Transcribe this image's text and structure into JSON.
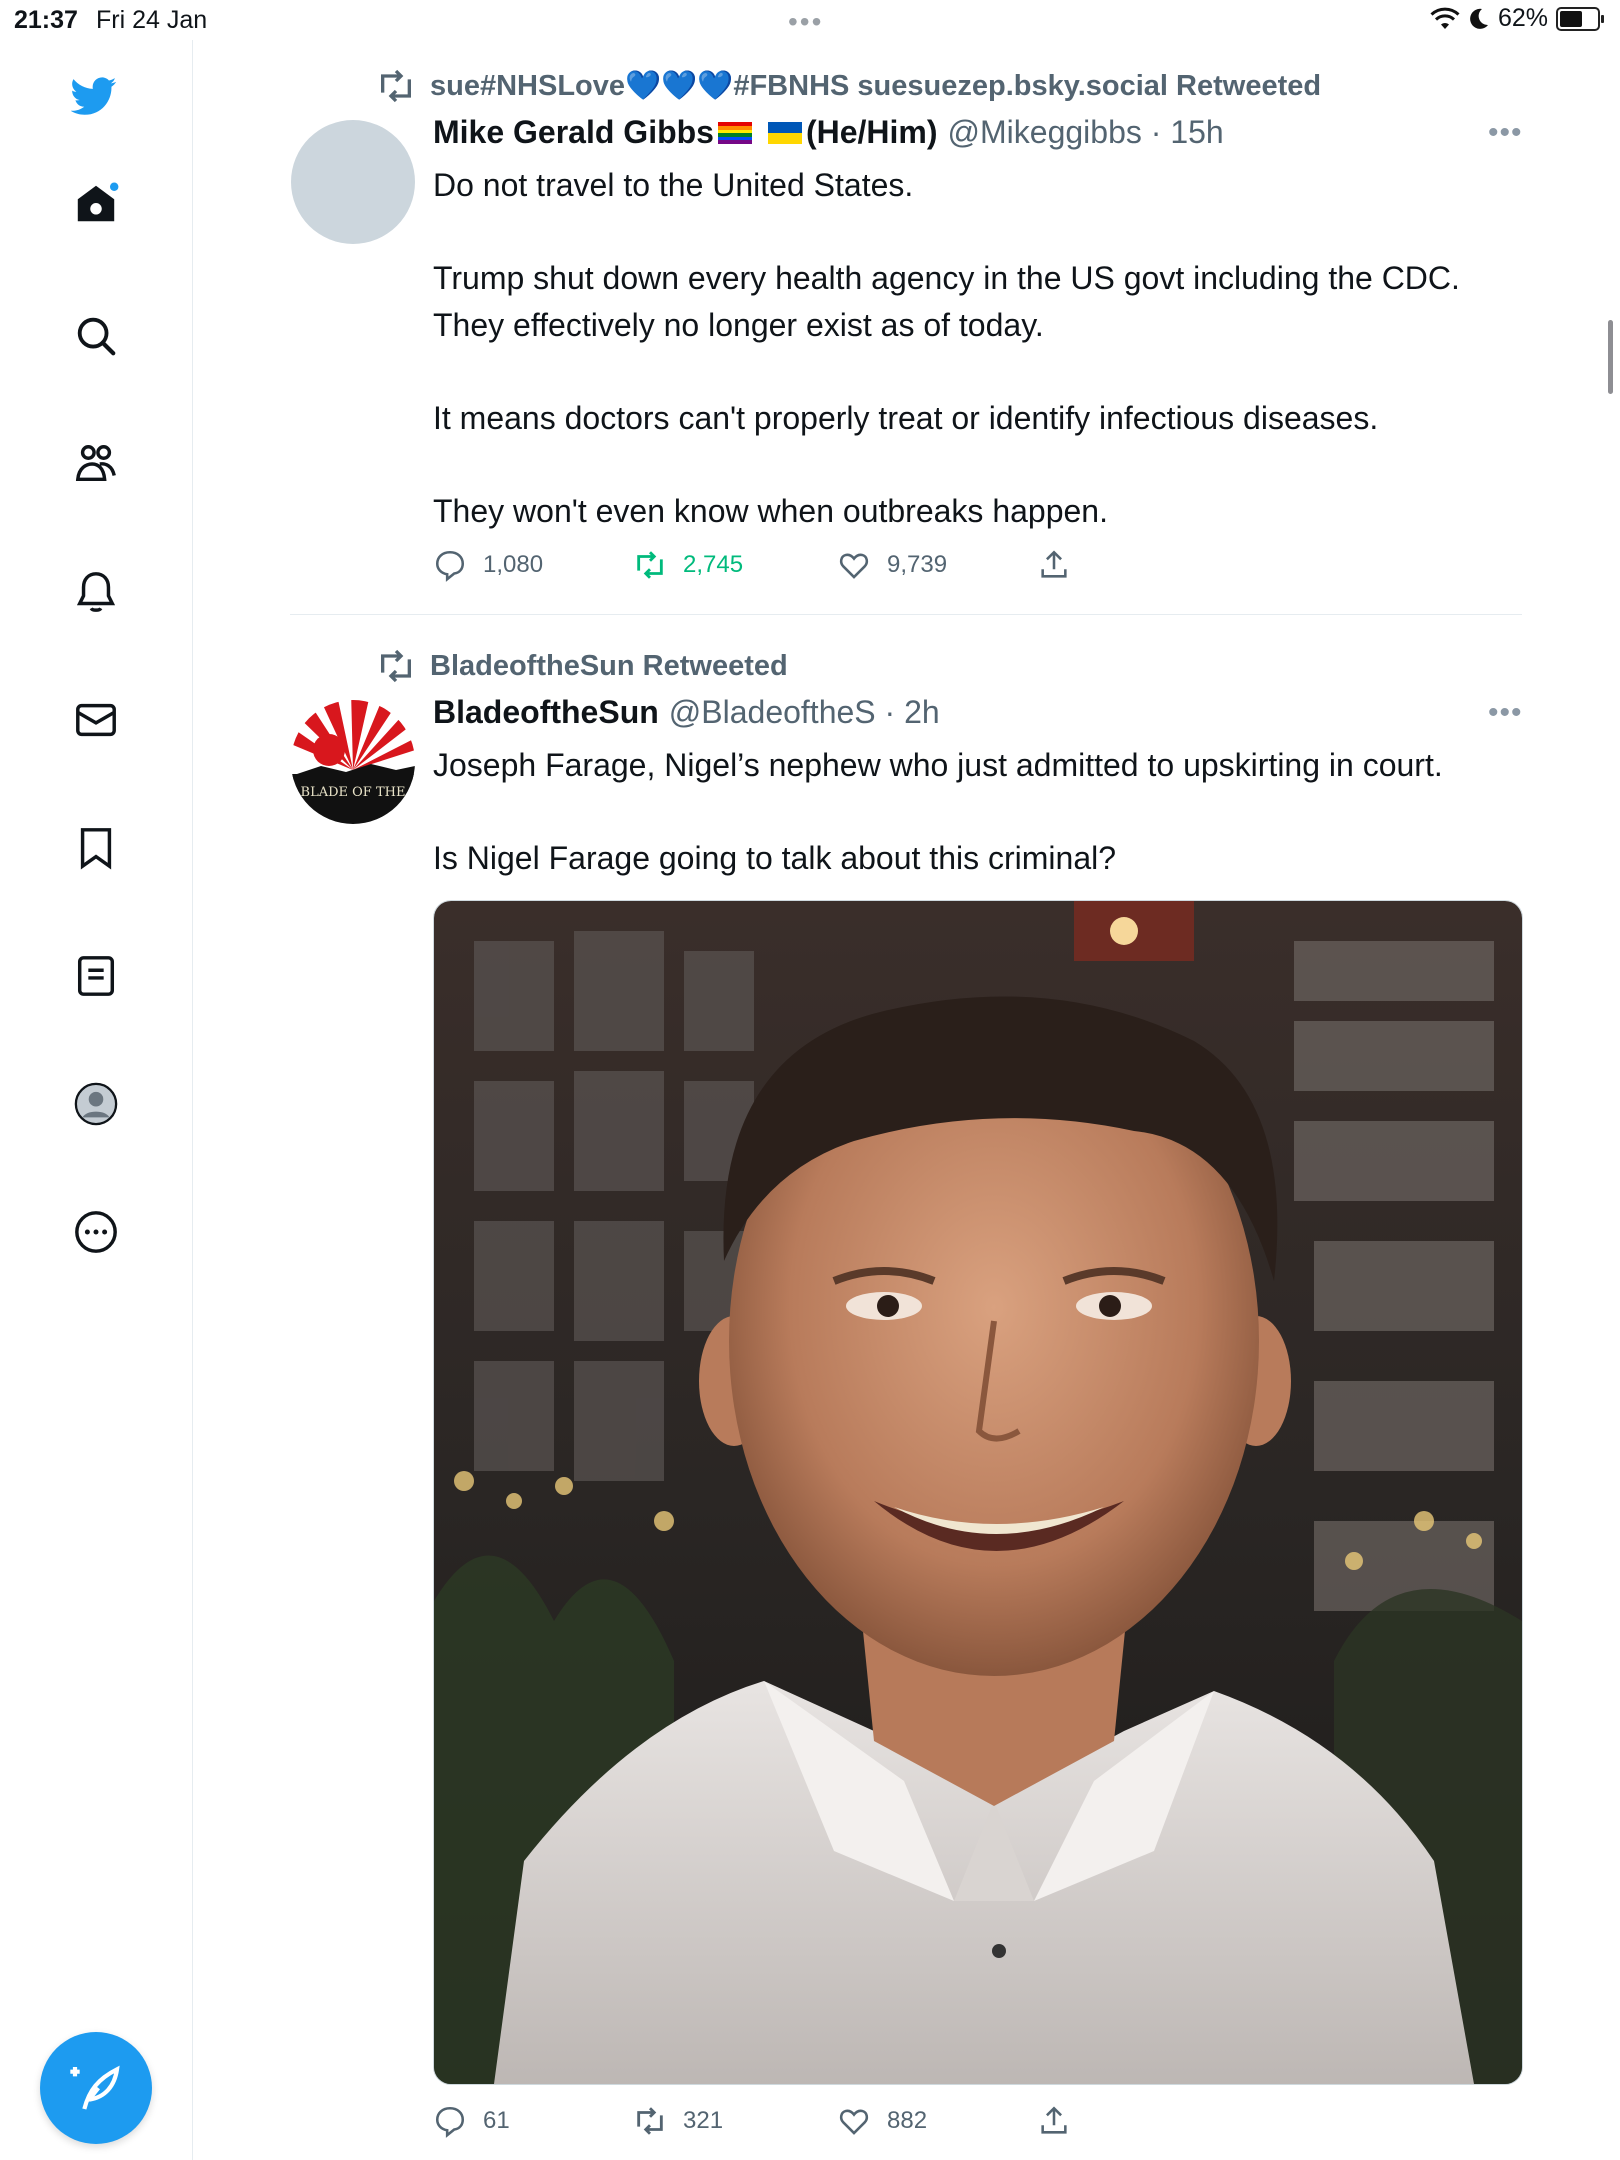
{
  "status_bar": {
    "time": "21:37",
    "date": "Fri 24 Jan",
    "battery": "62%",
    "battery_level": 0.62
  },
  "sidebar": {
    "items": [
      {
        "name": "home"
      },
      {
        "name": "search"
      },
      {
        "name": "communities"
      },
      {
        "name": "notifications"
      },
      {
        "name": "messages"
      },
      {
        "name": "bookmarks"
      },
      {
        "name": "lists"
      },
      {
        "name": "profile"
      },
      {
        "name": "more"
      }
    ]
  },
  "tweets": [
    {
      "retweeted_by": "sue#NHSLove💙💙💙#FBNHS suesuezep.bsky.social Retweeted",
      "name": "Mike Gerald Gibbs",
      "pronouns": "(He/Him)",
      "handle": "@Mikeggibbs · 15h",
      "more": "•••",
      "text": "Do not travel to the United States.\n\nTrump shut down every health agency in the US govt including the CDC. They effectively no longer exist as of today.\n\nIt means doctors can't properly treat or identify infectious diseases.\n\nThey won't even know when outbreaks happen.",
      "replies": "1,080",
      "retweets": "2,745",
      "likes": "9,739"
    },
    {
      "retweeted_by": "BladeoftheSun Retweeted",
      "name": "BladeoftheSun",
      "handle": "@BladeoftheS · 2h",
      "more": "•••",
      "avatar_text": "BLADE OF THE",
      "text": "Joseph Farage, Nigel’s nephew who just admitted to upskirting in court.\n\nIs Nigel Farage going to talk about this criminal?",
      "replies": "61",
      "retweets": "321",
      "likes": "882"
    }
  ],
  "colors": {
    "accent": "#1d9bf0",
    "retweet_green": "#00ba7c",
    "secondary_text": "#536471"
  }
}
